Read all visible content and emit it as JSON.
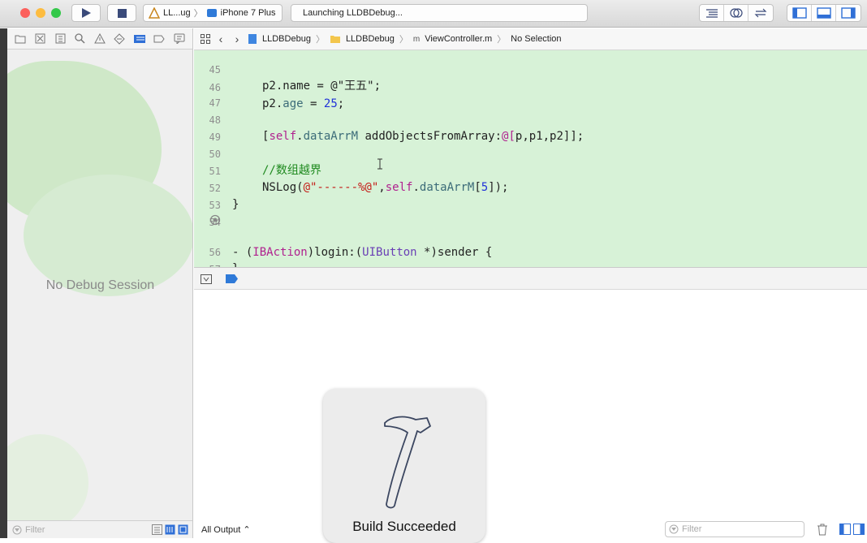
{
  "toolbar": {
    "scheme": "LL...ug",
    "device": "iPhone 7 Plus",
    "activity": "Launching LLDBDebug..."
  },
  "jumpbar": {
    "project": "LLDBDebug",
    "group": "LLDBDebug",
    "file": "ViewController.m",
    "selection": "No Selection"
  },
  "editor": {
    "line_numbers": [
      "45",
      "46",
      "47",
      "48",
      "49",
      "50",
      "51",
      "52",
      "53",
      "54",
      "55",
      "56",
      "57"
    ],
    "lines": {
      "l45": "p2.name = @\"王五\";",
      "l46a": "p2.",
      "l46b": "age",
      "l46c": " = ",
      "l46d": "25",
      "l46e": ";",
      "l48a": "[",
      "l48b": "self",
      "l48c": ".",
      "l48d": "dataArrM",
      "l48e": " addObjectsFromArray:",
      "l48f": "@[",
      "l48g": "p,p1,p2",
      "l48h": "]];",
      "l50": "//数组越界",
      "l51a": "NSLog(",
      "l51b": "@\"------%@\"",
      "l51c": ",",
      "l51d": "self",
      "l51e": ".",
      "l51f": "dataArrM",
      "l51g": "[",
      "l51h": "5",
      "l51i": "]);",
      "l52": "}",
      "l55a": "- (",
      "l55b": "IBAction",
      "l55c": ")login:(",
      "l55d": "UIButton",
      "l55e": " *)sender {",
      "l56": "}"
    }
  },
  "debug_navigator": {
    "status": "No Debug Session",
    "filter_placeholder": "Filter"
  },
  "console": {
    "output_selector": "All Output ⌃",
    "filter_placeholder": "Filter"
  },
  "hud": {
    "message": "Build Succeeded",
    "icon": "hammer-icon"
  },
  "colors": {
    "editor_highlight": "#d7f2d7",
    "keyword": "#b0218f",
    "number": "#2032d8",
    "string": "#c41a16",
    "comment": "#1f8a1f"
  }
}
